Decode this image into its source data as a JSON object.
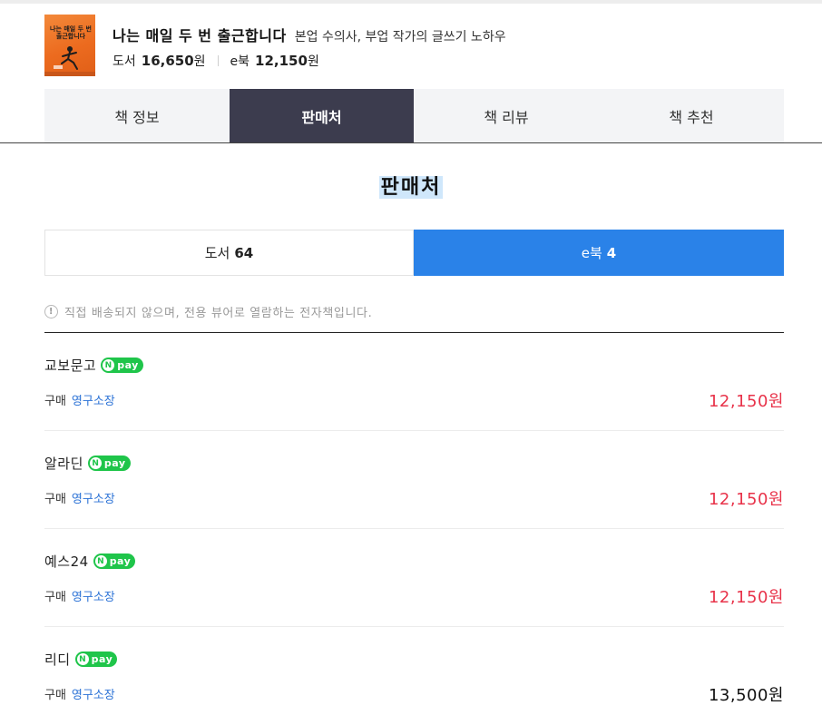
{
  "book": {
    "cover_title": "나는 매일 두 번 출근합니다",
    "title": "나는 매일 두 번 출근합니다",
    "subtitle": "본업 수의사, 부업 작가의 글쓰기 노하우",
    "print": {
      "label": "도서",
      "price": "16,650",
      "unit": "원"
    },
    "ebook": {
      "label": "e북",
      "price": "12,150",
      "unit": "원"
    }
  },
  "tabs": [
    {
      "label": "책 정보",
      "active": false
    },
    {
      "label": "판매처",
      "active": true
    },
    {
      "label": "책 리뷰",
      "active": false
    },
    {
      "label": "책 추천",
      "active": false
    }
  ],
  "section_title": "판매처",
  "format_toggle": {
    "print": {
      "label": "도서",
      "count": "64",
      "active": false
    },
    "ebook": {
      "label": "e북",
      "count": "4",
      "active": true
    }
  },
  "notice": "직접 배송되지 않으며, 전용 뷰어로 열람하는 전자책입니다.",
  "npay_label": "pay",
  "sellers": [
    {
      "name": "교보문고",
      "npay": true,
      "buy_label": "구매",
      "buy_type": "영구소장",
      "price": "12,150원",
      "price_color": "#e8334a"
    },
    {
      "name": "알라딘",
      "npay": true,
      "buy_label": "구매",
      "buy_type": "영구소장",
      "price": "12,150원",
      "price_color": "#e8334a"
    },
    {
      "name": "예스24",
      "npay": true,
      "buy_label": "구매",
      "buy_type": "영구소장",
      "price": "12,150원",
      "price_color": "#e8334a"
    },
    {
      "name": "리디",
      "npay": true,
      "buy_label": "구매",
      "buy_type": "영구소장",
      "price": "13,500원",
      "price_color": "#111111"
    }
  ],
  "colors": {
    "tab_active_bg": "#3c3c4e",
    "toggle_active_bg": "#2a82e8",
    "npay_green": "#1fc54a",
    "price_red": "#e8334a",
    "link_blue": "#2b72d6"
  }
}
